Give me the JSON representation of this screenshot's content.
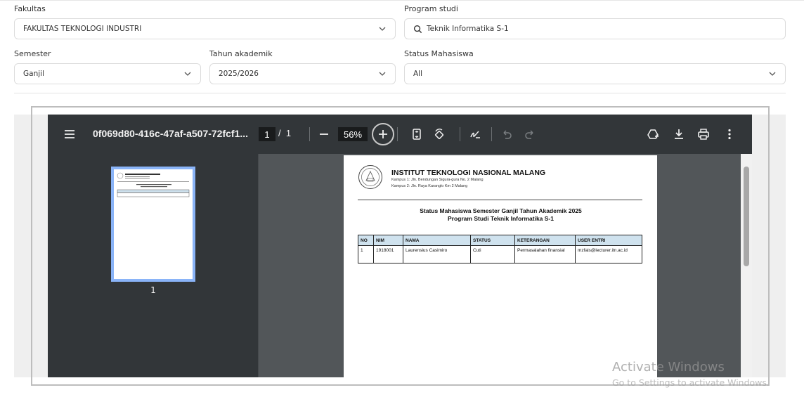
{
  "filters": {
    "fakultas": {
      "label": "Fakultas",
      "value": "FAKULTAS TEKNOLOGI INDUSTRI"
    },
    "program_studi": {
      "label": "Program studi",
      "value": "Teknik Informatika S-1"
    },
    "semester": {
      "label": "Semester",
      "value": "Ganjil"
    },
    "tahun_akademik": {
      "label": "Tahun akademik",
      "value": "2025/2026"
    },
    "status_mahasiswa": {
      "label": "Status Mahasiswa",
      "value": "All"
    }
  },
  "viewer": {
    "file_name": "0f069d80-416c-47af-a507-72fcf1...",
    "current_page": "1",
    "page_separator": "/",
    "total_pages": "1",
    "zoom": "56%",
    "thumbnail_label": "1"
  },
  "document": {
    "institution": "INSTITUT TEKNOLOGI NASIONAL MALANG",
    "address_1": "Kampus 1: Jln. Bendungan Sigura-gura No. 2 Malang",
    "address_2": "Kampus 2: Jln. Raya Karanglo Km 2 Malang",
    "title_1": "Status Mahasiswa Semester Ganjil Tahun Akademik 2025",
    "title_2": "Program Studi Teknik Informatika S-1",
    "columns": [
      "NO",
      "NIM",
      "NAMA",
      "STATUS",
      "KETERANGAN",
      "USER ENTRI"
    ],
    "rows": [
      {
        "no": "1",
        "nim": "1918001",
        "nama": "Laurensius Casimiro",
        "status": "Cuti",
        "keterangan": "Permasalahan finansial",
        "user": "mzfais@lecturer.itn.ac.id"
      }
    ]
  },
  "watermark": {
    "line1": "Activate Windows",
    "line2": "Go to Settings to activate Windows."
  }
}
